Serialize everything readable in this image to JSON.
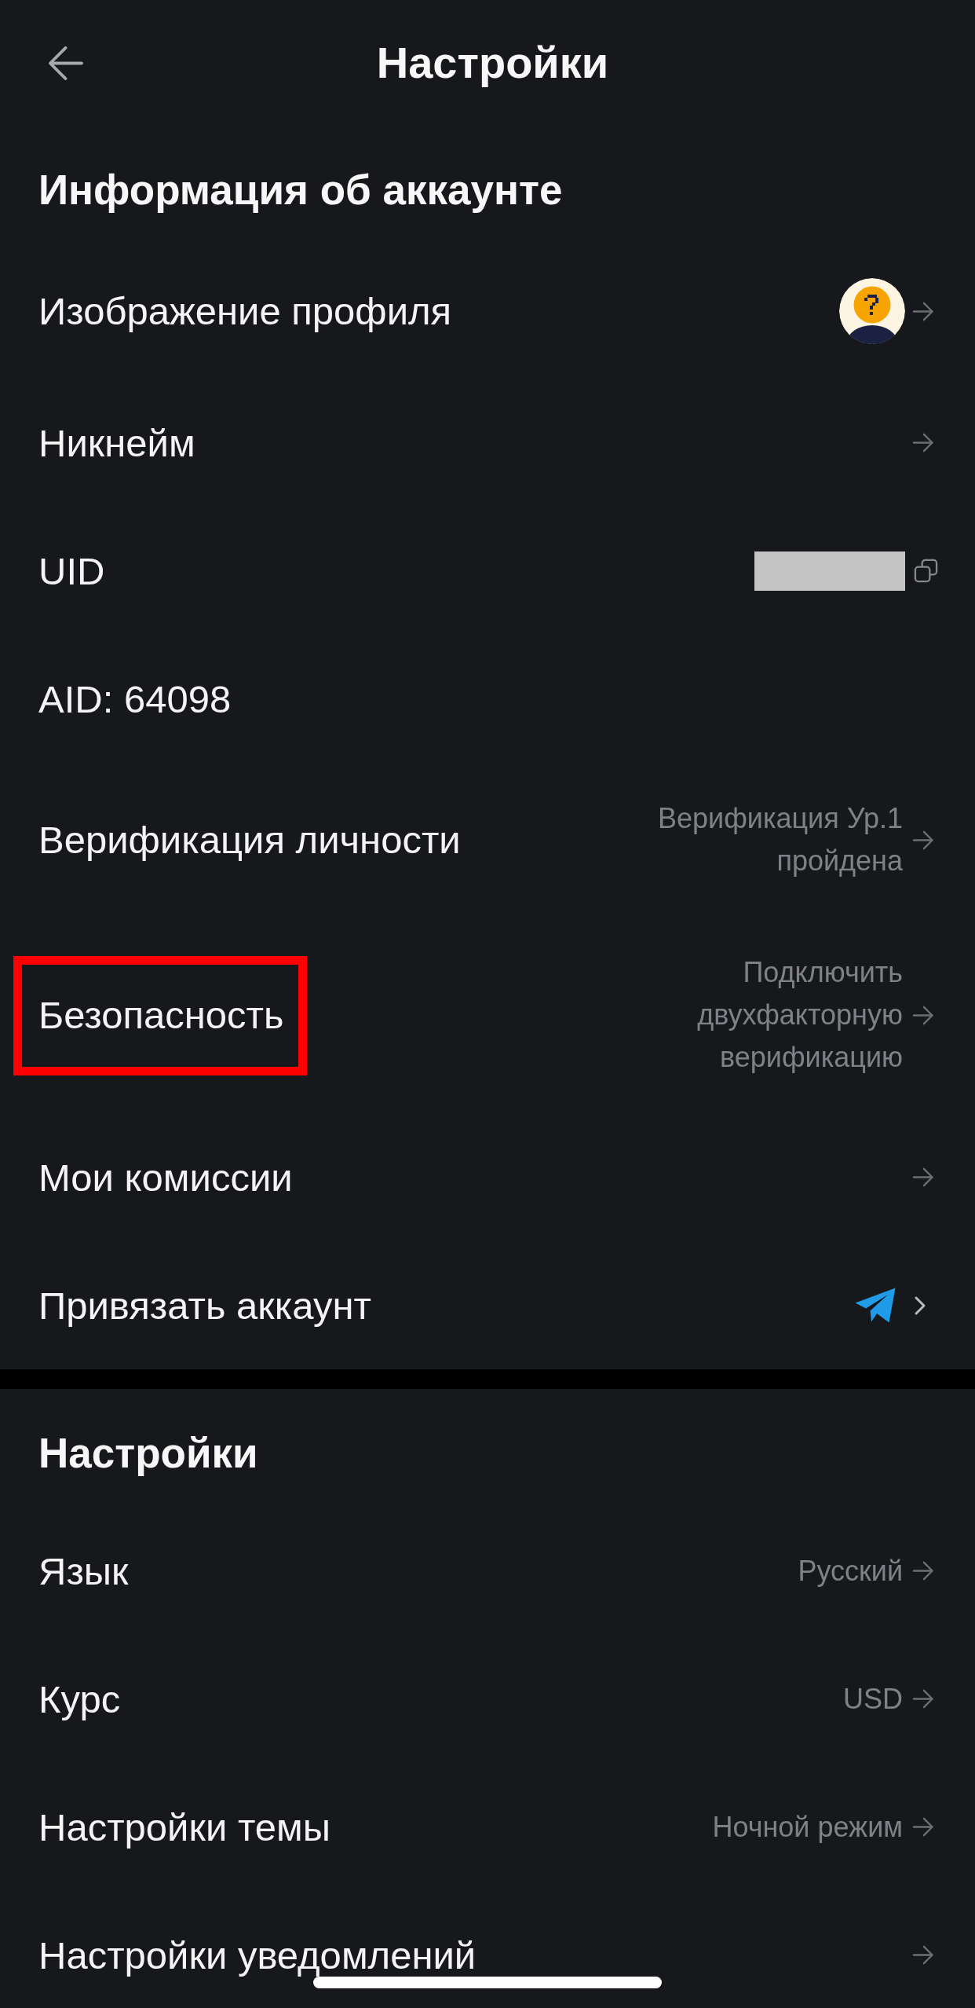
{
  "header": {
    "title": "Настройки"
  },
  "sections": [
    {
      "title": "Информация об аккаунте",
      "items": [
        {
          "kind": "avatar",
          "label": "Изображение профиля",
          "highlighted": false
        },
        {
          "kind": "link",
          "label": "Никнейм",
          "highlighted": false
        },
        {
          "kind": "copy",
          "label": "UID",
          "highlighted": false
        },
        {
          "kind": "plain",
          "label": "AID: 64098",
          "highlighted": false
        },
        {
          "kind": "link",
          "label": "Верификация личности",
          "value": "Верификация Ур.1 пройдена",
          "highlighted": false
        },
        {
          "kind": "link",
          "label": "Безопасность",
          "value": "Подключить двухфакторную верификацию",
          "highlighted": true
        },
        {
          "kind": "link",
          "label": "Мои комиссии",
          "highlighted": false
        },
        {
          "kind": "social",
          "label": "Привязать аккаунт",
          "highlighted": false
        }
      ]
    },
    {
      "title": "Настройки",
      "items": [
        {
          "kind": "link",
          "label": "Язык",
          "value": "Русский",
          "highlighted": false
        },
        {
          "kind": "link",
          "label": "Курс",
          "value": "USD",
          "highlighted": false
        },
        {
          "kind": "link",
          "label": "Настройки темы",
          "value": "Ночной режим",
          "highlighted": false
        },
        {
          "kind": "link",
          "label": "Настройки уведомлений",
          "highlighted": false
        }
      ]
    }
  ]
}
